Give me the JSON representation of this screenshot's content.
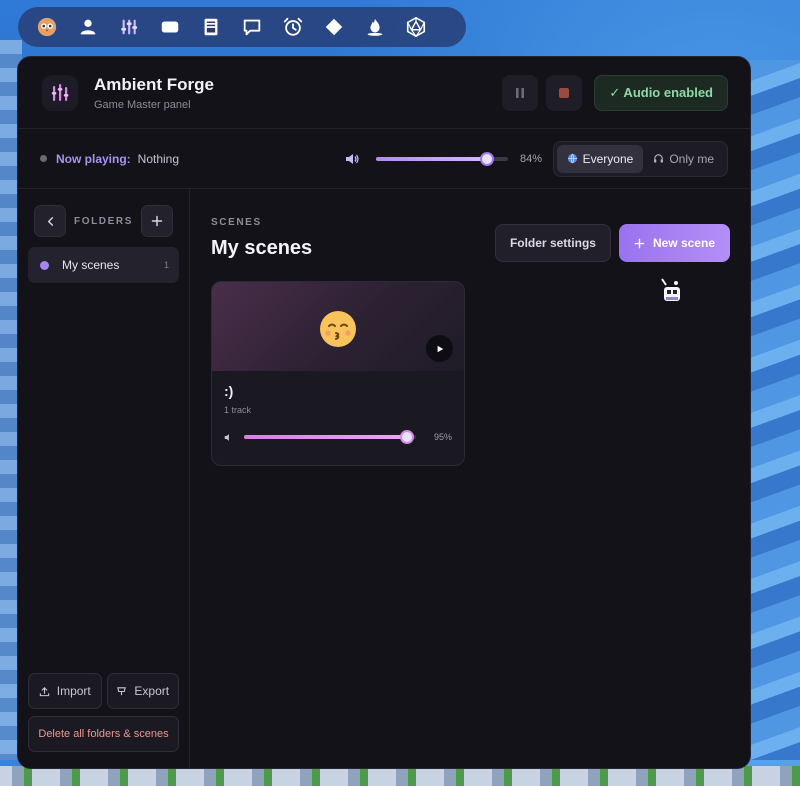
{
  "toolbar": {
    "icons": [
      "owl-icon",
      "user-icon",
      "mixer-icon",
      "card-icon",
      "journal-icon",
      "chat-icon",
      "alarm-icon",
      "diamond-icon",
      "fire-icon",
      "d20-icon"
    ]
  },
  "header": {
    "title": "Ambient Forge",
    "subtitle": "Game Master panel",
    "audio_label": "✓ Audio enabled"
  },
  "now_playing": {
    "label": "Now playing:",
    "value": "Nothing",
    "volume_pct_label": "84%",
    "volume": 0.84,
    "audience": {
      "everyone": "Everyone",
      "only_me": "Only me",
      "selected": "everyone"
    }
  },
  "sidebar": {
    "title": "FOLDERS",
    "folders": [
      {
        "name": "My scenes",
        "count": "1",
        "color": "#a686f2"
      }
    ],
    "import_label": "Import",
    "export_label": "Export",
    "delete_label": "Delete all folders & scenes"
  },
  "main": {
    "eyebrow": "SCENES",
    "title": "My scenes",
    "folder_settings_label": "Folder settings",
    "new_scene_label": "New scene",
    "scenes": [
      {
        "name": ":)",
        "tracks": "1 track",
        "volume_pct_label": "95%",
        "volume": 0.95,
        "emoji": "kissing-face-icon"
      }
    ]
  },
  "colors": {
    "accent": "#a686f2",
    "audio_enabled": "#8fd9a4",
    "danger": "#e89a8c"
  }
}
